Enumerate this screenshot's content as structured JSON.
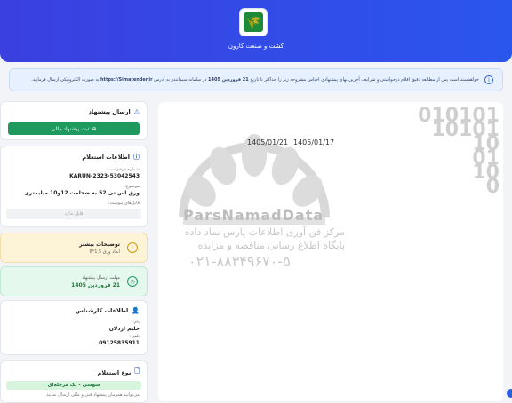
{
  "header": {
    "company_name": "کشت و صنعت کارون",
    "logo_glyph": "🌾",
    "gradient": [
      "#3b3fe0",
      "#2a56ee"
    ]
  },
  "notice": {
    "text_before": "خواهشمند است پس از مطالعه دقیق اقلام درخواستی و شرایط، آخرین بهای پیشنهادی اجناس مشروحه زیر را حداکثر تا تاریخ",
    "deadline": "21 فروردین 1405",
    "text_middle": "در سامانه سیماتندر به آدرس",
    "link": "https://Simatender.ir",
    "text_after": "به صورت الکترونیکی ارسال فرمایید."
  },
  "send_offer": {
    "title": "ارسال پیشنهاد",
    "button_label": "ثبت پیشنهاد مالی",
    "button_color": "#1f9a5e"
  },
  "inquiry_info": {
    "title": "اطلاعات استعلام",
    "request_number_label": "شماره درخواست:",
    "request_number": "KARUN-2323-53042543",
    "subject_label": "موضوع:",
    "subject": "ورق اس تی 52 به ضخامت 12و10 میلیمتری",
    "attachments_label": "فایل‌های پیوست:",
    "attachments_empty": "فایل ندارد"
  },
  "more_info": {
    "title": "توضیحات بیشتر",
    "text": "ابعاد ورق 1.5*6"
  },
  "deadline_card": {
    "label": "مهلت ارسال پیشنهاد",
    "value": "21 فروردین 1405"
  },
  "expert_info": {
    "title": "اطلاعات کارشناس",
    "name_label": "نام:",
    "name": "حلیم اردلان",
    "phone_label": "تلفن:",
    "phone": "09125835911"
  },
  "inquiry_type": {
    "title": "نوع استعلام",
    "badge": "سوسی - تک مرحله‌ای",
    "note": "می‌توانید همزمان پیشنهاد فنی و مالی ارسال نمایید"
  },
  "document": {
    "date_left": "1405/01/21",
    "date_right": "1405/01/17",
    "watermark_digits": [
      "010101",
      "10101",
      "10",
      "01",
      "10",
      "0"
    ],
    "watermark_name": "ParsNamadData",
    "watermark_line1": "مرکز فن آوری اطلاعات پارس نماد داده",
    "watermark_line2": "پایگاه اطلاع رسانی مناقصه و مزایده",
    "watermark_phone": "۰۲۱-۸۸۳۴۹۶۷۰-۵"
  },
  "colors": {
    "accent": "#2b5fd9",
    "more_info_bg": "#fdf3d6",
    "deadline_bg": "#e4f8ee"
  }
}
